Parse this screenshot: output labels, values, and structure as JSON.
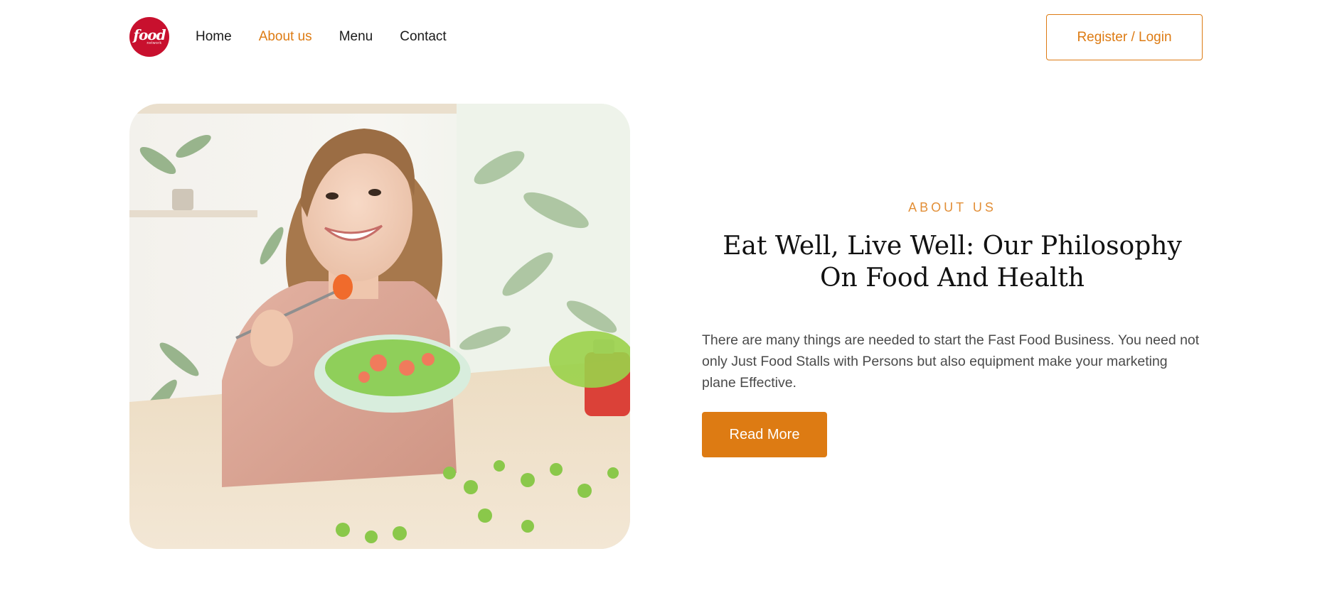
{
  "header": {
    "logo": {
      "word": "food",
      "sub": "network"
    },
    "nav": [
      {
        "label": "Home",
        "active": false
      },
      {
        "label": "About us",
        "active": true
      },
      {
        "label": "Menu",
        "active": false
      },
      {
        "label": "Contact",
        "active": false
      }
    ],
    "login_label": "Register / Login"
  },
  "about": {
    "eyebrow": "ABOUT US",
    "title": "Eat Well, Live Well: Our Philosophy On Food And Health",
    "description": "There are many things are needed to start the Fast Food Business. You need not only Just Food Stalls with Persons but also equipment make your marketing plane Effective.",
    "button_label": "Read More"
  },
  "image": {
    "subject": "woman-eating-salad-photo"
  },
  "colors": {
    "accent": "#dd7b13",
    "logo": "#c8102e",
    "text": "#1a1a1a",
    "muted": "#4a4a4a"
  }
}
